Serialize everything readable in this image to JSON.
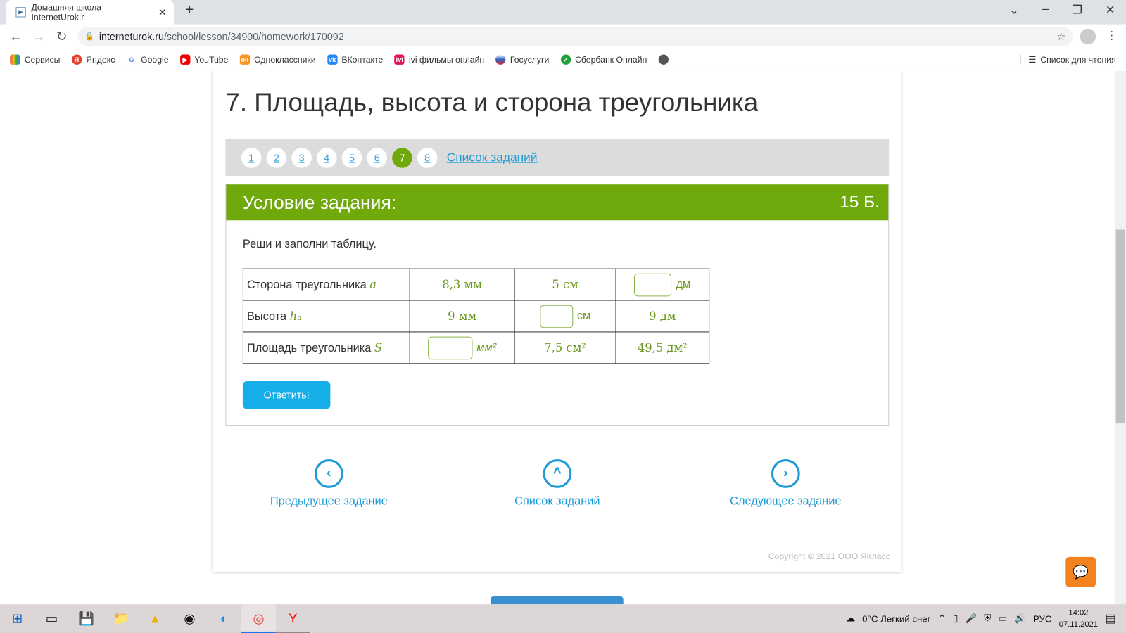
{
  "browser": {
    "tab_title": "Домашняя школа InternetUrok.r",
    "url_host": "interneturok.ru",
    "url_path": "/school/lesson/34900/homework/170092",
    "bookmarks": [
      "Сервисы",
      "Яндекс",
      "Google",
      "YouTube",
      "Одноклассники",
      "ВКонтакте",
      "ivi фильмы онлайн",
      "Госуслуги",
      "Сбербанк Онлайн"
    ],
    "reading_list": "Список для чтения"
  },
  "page": {
    "title": "7. Площадь, высота и сторона треугольника",
    "pager": {
      "pages": [
        "1",
        "2",
        "3",
        "4",
        "5",
        "6",
        "7",
        "8"
      ],
      "active": "7",
      "list_label": "Список заданий"
    },
    "task": {
      "header": "Условие задания:",
      "points": "15 Б.",
      "instruction": "Реши и заполни таблицу.",
      "rows": [
        {
          "label": "Сторона треугольника ",
          "var": "a",
          "cells": [
            "8,3 мм",
            "5 см",
            ""
          ],
          "unit3": "дм"
        },
        {
          "label": "Высота ",
          "var": "hₐ",
          "cells": [
            "9 мм",
            "",
            "9 дм"
          ],
          "unit2": "см"
        },
        {
          "label": "Площадь треугольника ",
          "var": "S",
          "cells": [
            "",
            "7,5 см²",
            "49,5 дм²"
          ],
          "unit1": "мм²"
        }
      ],
      "answer_button": "Ответить!"
    },
    "nav": {
      "prev": "Предыдущее задание",
      "list": "Список заданий",
      "next": "Следующее задание"
    },
    "copyright": "Copyright © 2021 ООО ЯКласс"
  },
  "taskbar": {
    "weather": "0°C  Легкий снег",
    "lang": "РУС",
    "time": "14:02",
    "date": "07.11.2021"
  },
  "colors": {
    "accent_green": "#6fa90c",
    "link_blue": "#1e9bd7",
    "button_blue": "#15aee8"
  }
}
